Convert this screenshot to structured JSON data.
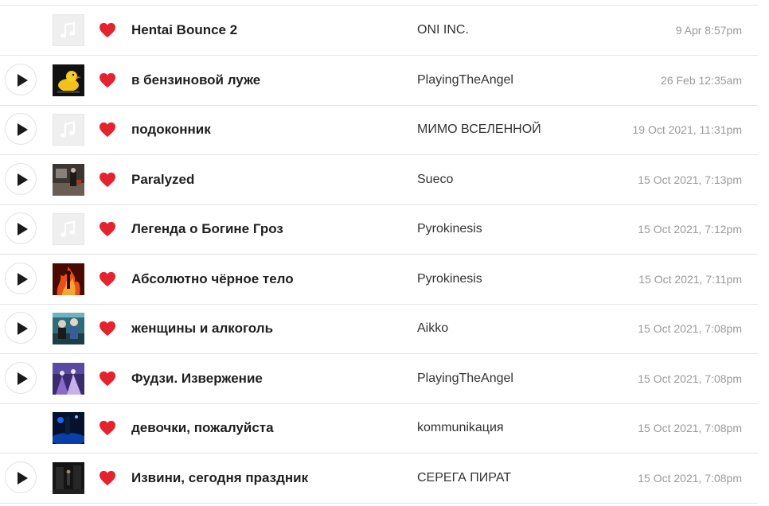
{
  "colors": {
    "heart": "#e5232f",
    "divider": "#e4e4e4",
    "title": "#1f1f1f",
    "artist": "#333333",
    "date": "#9a9a9a"
  },
  "tracks": [
    {
      "title": "Hentai Bounce 2",
      "artist": "ONI INC.",
      "date": "9 Apr 8:57pm",
      "has_play": false,
      "cover": "music-note-placeholder-icon",
      "liked": true
    },
    {
      "title": "в бензиновой луже",
      "artist": "PlayingTheAngel",
      "date": "26 Feb 12:35am",
      "has_play": true,
      "cover": "rubber-duck-artwork",
      "liked": true
    },
    {
      "title": "подоконник",
      "artist": "МИМО ВСЕЛЕННОЙ",
      "date": "19 Oct 2021, 11:31pm",
      "has_play": true,
      "cover": "music-note-placeholder-icon",
      "liked": true
    },
    {
      "title": "Paralyzed",
      "artist": "Sueco",
      "date": "15 Oct 2021, 7:13pm",
      "has_play": true,
      "cover": "dark-room-artwork",
      "liked": true
    },
    {
      "title": "Легенда о Богине Гроз",
      "artist": "Pyrokinesis",
      "date": "15 Oct 2021, 7:12pm",
      "has_play": true,
      "cover": "music-note-placeholder-icon",
      "liked": true
    },
    {
      "title": "Абсолютно чёрное тело",
      "artist": "Pyrokinesis",
      "date": "15 Oct 2021, 7:11pm",
      "has_play": true,
      "cover": "fire-artwork",
      "liked": true
    },
    {
      "title": "женщины и алкоголь",
      "artist": "Aikko",
      "date": "15 Oct 2021, 7:08pm",
      "has_play": true,
      "cover": "teal-figures-artwork",
      "liked": true
    },
    {
      "title": "Фудзи. Извержение",
      "artist": "PlayingTheAngel",
      "date": "15 Oct 2021, 7:08pm",
      "has_play": true,
      "cover": "purple-figures-artwork",
      "liked": true
    },
    {
      "title": "девочки, пожалуйста",
      "artist": "kommunikация",
      "date": "15 Oct 2021, 7:08pm",
      "has_play": false,
      "cover": "blue-stage-artwork",
      "liked": true
    },
    {
      "title": "Извини, сегодня праздник",
      "artist": "СЕРЕГА ПИРАТ",
      "date": "15 Oct 2021, 7:08pm",
      "has_play": true,
      "cover": "dark-street-artwork",
      "liked": true
    }
  ]
}
